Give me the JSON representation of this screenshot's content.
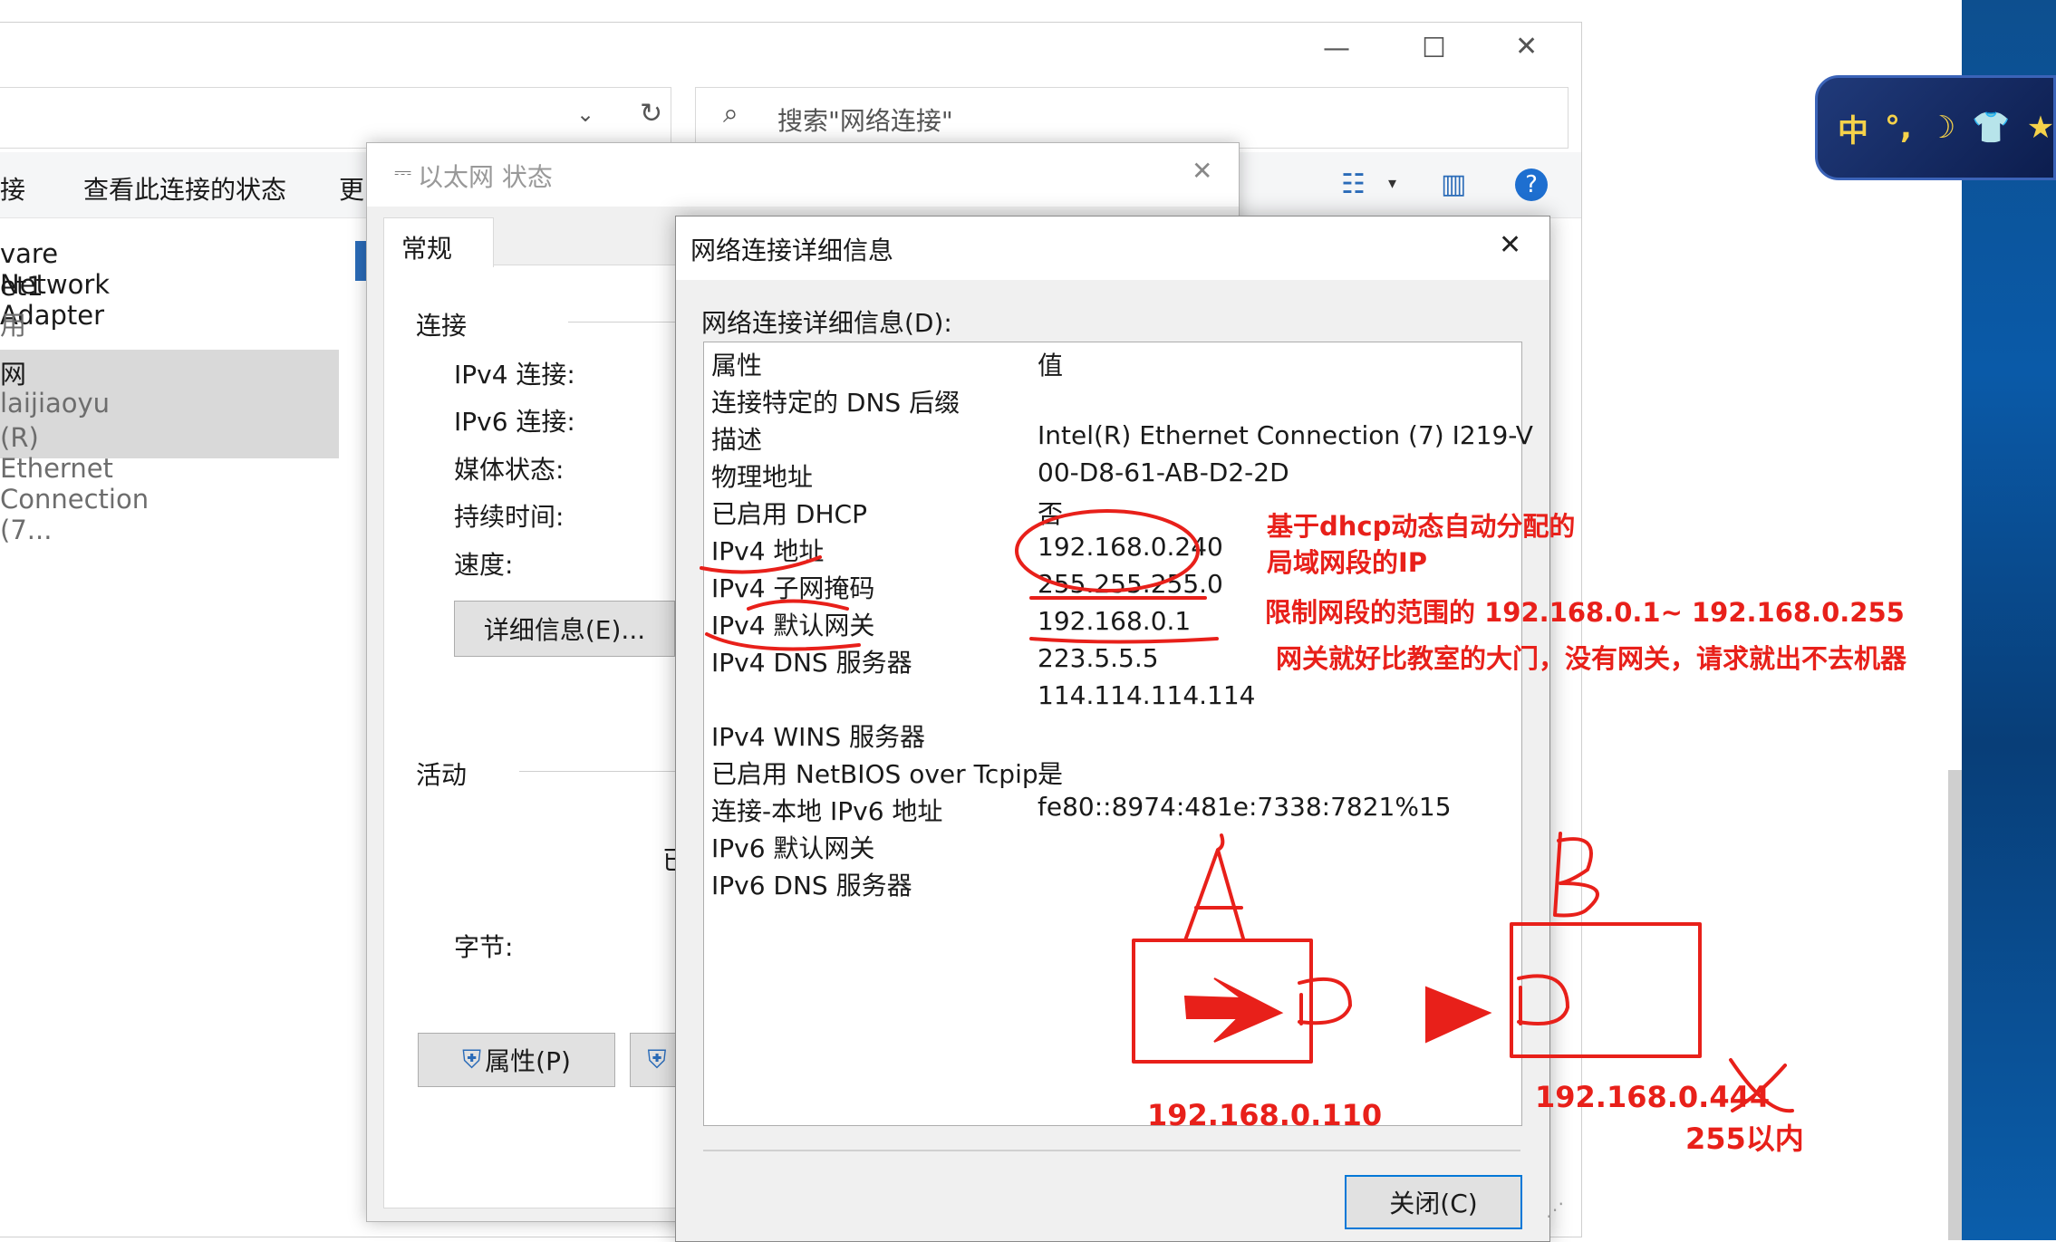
{
  "explorer": {
    "search_placeholder": "搜索\"网络连接\"",
    "toolbar": {
      "item_partial": "接",
      "view_status": "查看此连接的状态",
      "more_partial": "更"
    },
    "adapters": [
      {
        "line1": "vare Network Adapter",
        "line2": "et1",
        "line3": "用"
      },
      {
        "line1": "网",
        "line2": "laijiaoyu",
        "line3": "(R) Ethernet Connection (7..."
      }
    ]
  },
  "status_dialog": {
    "title": "以太网 状态",
    "tab_general": "常规",
    "section_connection": "连接",
    "ipv4": "IPv4 连接:",
    "ipv6": "IPv6 连接:",
    "media": "媒体状态:",
    "duration": "持续时间:",
    "speed": "速度:",
    "details_button": "详细信息(E)...",
    "section_activity": "活动",
    "activity_partial": "已",
    "bytes": "字节:",
    "properties_button": "属性(P)"
  },
  "detail_dialog": {
    "title": "网络连接详细信息",
    "list_label": "网络连接详细信息(D):",
    "col_property": "属性",
    "col_value": "值",
    "rows": [
      {
        "k": "连接特定的 DNS 后缀",
        "v": ""
      },
      {
        "k": "描述",
        "v": "Intel(R) Ethernet Connection (7) I219-V"
      },
      {
        "k": "物理地址",
        "v": "00-D8-61-AB-D2-2D"
      },
      {
        "k": "已启用 DHCP",
        "v": "否"
      },
      {
        "k": "IPv4 地址",
        "v": "192.168.0.240"
      },
      {
        "k": "IPv4 子网掩码",
        "v": "255.255.255.0"
      },
      {
        "k": "IPv4 默认网关",
        "v": "192.168.0.1"
      },
      {
        "k": "IPv4 DNS 服务器",
        "v": "223.5.5.5"
      },
      {
        "k": "",
        "v": "114.114.114.114"
      },
      {
        "k": "IPv4 WINS 服务器",
        "v": ""
      },
      {
        "k": "已启用 NetBIOS over Tcpip",
        "v": "是"
      },
      {
        "k": "连接-本地 IPv6 地址",
        "v": "fe80::8974:481e:7338:7821%15"
      },
      {
        "k": "IPv6 默认网关",
        "v": ""
      },
      {
        "k": "IPv6 DNS 服务器",
        "v": ""
      }
    ],
    "close_button": "关闭(C)"
  },
  "ime": {
    "label": "中"
  },
  "annotations": {
    "dhcp_line1": "基于dhcp动态自动分配的",
    "dhcp_line2": "局域网段的IP",
    "range": "限制网段的范围的 192.168.0.1~ 192.168.0.255",
    "gateway": "网关就好比教室的大门，没有网关，请求就出不去机器",
    "ip_a": "192.168.0.110",
    "ip_b": "192.168.0.444",
    "within": "255以内"
  },
  "colors": {
    "annotation": "#e8201a",
    "accent": "#0078d7"
  }
}
